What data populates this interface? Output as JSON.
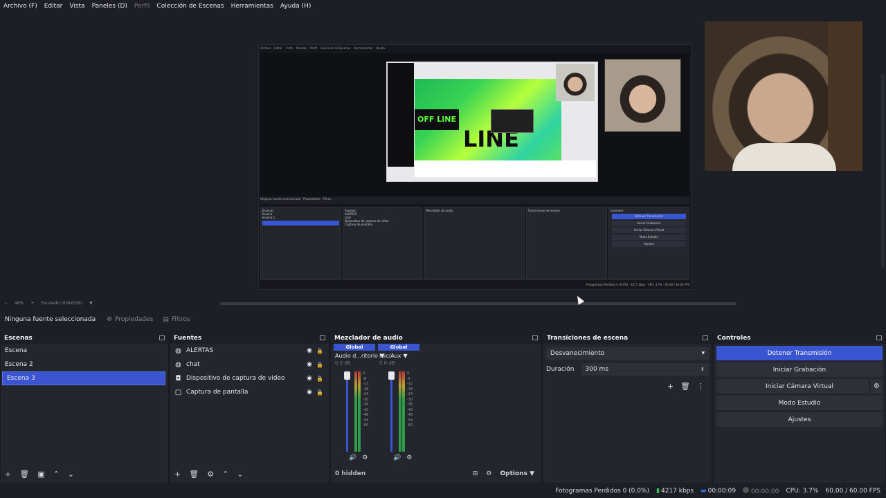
{
  "menu": [
    "Archivo (F)",
    "Editar",
    "Vista",
    "Paneles (D)",
    "Perfil",
    "Colección de Escenas",
    "Herramientas",
    "Ayuda (H)"
  ],
  "zoombar": {
    "zoom": "48%",
    "scaling": "Escalado (939x528)"
  },
  "context": {
    "no_source": "Ninguna fuente seleccionada",
    "properties": "Propiedades",
    "filters": "Filtros"
  },
  "scenes": {
    "title": "Escenas",
    "items": [
      "Escena",
      "Escena 2",
      "Escena 3"
    ],
    "selected": "Escena 3"
  },
  "sources": {
    "title": "Fuentes",
    "items": [
      {
        "name": "ALERTAS",
        "icon": "globe-icon"
      },
      {
        "name": "chat",
        "icon": "globe-icon"
      },
      {
        "name": "Dispositivo de captura de video",
        "icon": "camera-icon"
      },
      {
        "name": "Captura de pantalla",
        "icon": "monitor-icon"
      }
    ]
  },
  "mixer": {
    "title": "Mezclador de audio",
    "channels": [
      {
        "badge": "Global",
        "name": "Audio d...ritorio",
        "db": "0.0 dB"
      },
      {
        "badge": "Global",
        "name": "Mic/Aux",
        "db": "0.0 dB"
      }
    ],
    "scale": [
      "0",
      "-6",
      "-12",
      "-18",
      "-24",
      "-30",
      "-36",
      "-42",
      "-48",
      "-54",
      "-60"
    ],
    "hidden": "0 hidden",
    "options": "Options"
  },
  "transitions": {
    "title": "Transiciones de escena",
    "selected": "Desvanecimiento",
    "duration_label": "Duración",
    "duration_value": "300 ms"
  },
  "controls": {
    "title": "Controles",
    "buttons": [
      "Detener Transmisión",
      "Iniciar Grabación",
      "Iniciar Cámara Virtual",
      "Modo Estudio",
      "Ajustes"
    ]
  },
  "status": {
    "dropped": "Fotogramas Perdidos 0 (0.0%)",
    "bitrate": "4217 kbps",
    "stream_time": "00:00:09",
    "rec_time": "00:00:00",
    "cpu": "CPU: 3.7%",
    "fps": "60.00 / 60.00 FPS"
  },
  "colors": {
    "accent": "#3a55d1",
    "bg": "#1d1f26",
    "dock": "#24262d"
  }
}
